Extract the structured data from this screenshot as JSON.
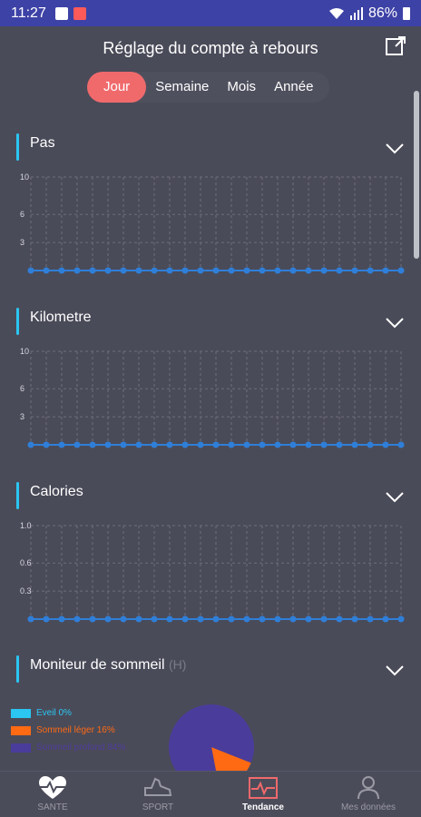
{
  "status_bar": {
    "time": "11:27",
    "battery": "86%"
  },
  "header": {
    "title": "Réglage du compte à rebours"
  },
  "tabs": [
    {
      "label": "Jour",
      "active": true
    },
    {
      "label": "Semaine",
      "active": false
    },
    {
      "label": "Mois",
      "active": false
    },
    {
      "label": "Année",
      "active": false
    }
  ],
  "sections": [
    {
      "title": "Pas"
    },
    {
      "title": "Kilometre"
    },
    {
      "title": "Calories"
    },
    {
      "title": "Moniteur de sommeil",
      "unit": "(H)"
    }
  ],
  "chart_data": [
    {
      "type": "line",
      "title": "Pas",
      "yticks": [
        "10",
        "6",
        "3"
      ],
      "ylim": [
        0,
        10
      ],
      "x": [
        1,
        2,
        3,
        4,
        5,
        6,
        7,
        8,
        9,
        10,
        11,
        12,
        13,
        14,
        15,
        16,
        17,
        18,
        19,
        20,
        21,
        22,
        23,
        24,
        25
      ],
      "values": [
        0,
        0,
        0,
        0,
        0,
        0,
        0,
        0,
        0,
        0,
        0,
        0,
        0,
        0,
        0,
        0,
        0,
        0,
        0,
        0,
        0,
        0,
        0,
        0,
        0
      ],
      "grid": true,
      "color": "#2f7fd8"
    },
    {
      "type": "line",
      "title": "Kilometre",
      "yticks": [
        "10",
        "6",
        "3"
      ],
      "ylim": [
        0,
        10
      ],
      "x": [
        1,
        2,
        3,
        4,
        5,
        6,
        7,
        8,
        9,
        10,
        11,
        12,
        13,
        14,
        15,
        16,
        17,
        18,
        19,
        20,
        21,
        22,
        23,
        24,
        25
      ],
      "values": [
        0,
        0,
        0,
        0,
        0,
        0,
        0,
        0,
        0,
        0,
        0,
        0,
        0,
        0,
        0,
        0,
        0,
        0,
        0,
        0,
        0,
        0,
        0,
        0,
        0
      ],
      "grid": true,
      "color": "#2f7fd8"
    },
    {
      "type": "line",
      "title": "Calories",
      "yticks": [
        "1.0",
        "0.6",
        "0.3"
      ],
      "ylim": [
        0,
        1
      ],
      "x": [
        1,
        2,
        3,
        4,
        5,
        6,
        7,
        8,
        9,
        10,
        11,
        12,
        13,
        14,
        15,
        16,
        17,
        18,
        19,
        20,
        21,
        22,
        23,
        24,
        25
      ],
      "values": [
        0,
        0,
        0,
        0,
        0,
        0,
        0,
        0,
        0,
        0,
        0,
        0,
        0,
        0,
        0,
        0,
        0,
        0,
        0,
        0,
        0,
        0,
        0,
        0,
        0
      ],
      "grid": true,
      "color": "#2f7fd8"
    },
    {
      "type": "pie",
      "title": "Moniteur de sommeil",
      "labels": [
        "Eveil 0%",
        "Sommeil léger 16%",
        "Sommeil profond 84%"
      ],
      "values": [
        0,
        16,
        84
      ],
      "colors": [
        "#2bc6f2",
        "#ff6a13",
        "#4a3c9b"
      ]
    }
  ],
  "legend": [
    {
      "label": "Eveil 0%",
      "color": "#2bc6f2"
    },
    {
      "label": "Sommeil léger 16%",
      "color": "#ff6a13"
    },
    {
      "label": "Sommeil profond 84%",
      "color": "#4a3c9b"
    }
  ],
  "bottom_nav": [
    {
      "label": "SANTE",
      "icon": "heart-pulse-icon",
      "active": false
    },
    {
      "label": "SPORT",
      "icon": "shoe-icon",
      "active": false
    },
    {
      "label": "Tendance",
      "icon": "trend-icon",
      "active": true
    },
    {
      "label": "Mes données",
      "icon": "person-icon",
      "active": false
    }
  ]
}
